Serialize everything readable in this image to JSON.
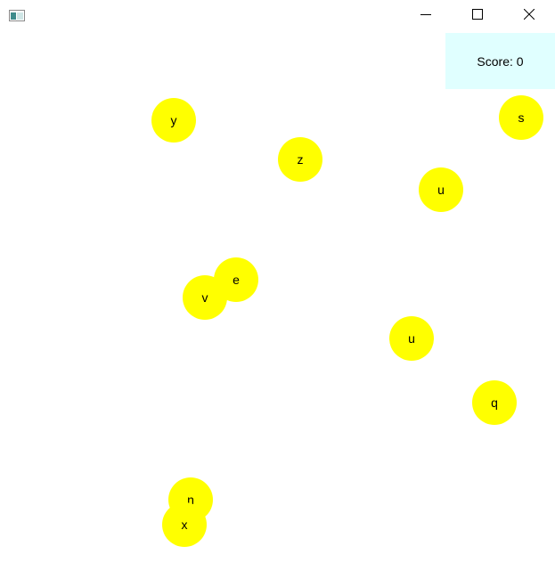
{
  "window": {
    "icon": "window-app-icon",
    "controls": {
      "minimize_icon": "minimize-icon",
      "maximize_icon": "maximize-icon",
      "close_icon": "close-icon"
    }
  },
  "score": {
    "label": "Score: 0"
  },
  "colors": {
    "ball": "#ffff00",
    "score_panel": "#e0ffff",
    "background": "#ffffff"
  },
  "balls": [
    {
      "letter": "y"
    },
    {
      "letter": "z"
    },
    {
      "letter": "s"
    },
    {
      "letter": "u"
    },
    {
      "letter": "e"
    },
    {
      "letter": "v"
    },
    {
      "letter": "u"
    },
    {
      "letter": "q"
    },
    {
      "letter": "n"
    },
    {
      "letter": "x"
    }
  ]
}
